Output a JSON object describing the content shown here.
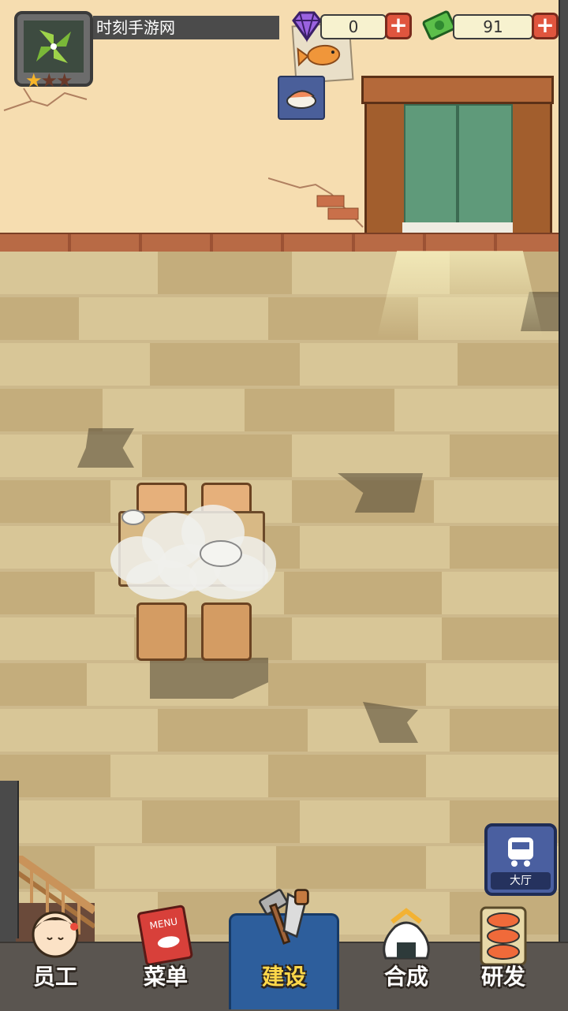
{
  "player": {
    "name": "时刻手游网",
    "stars_filled": 1,
    "stars_total": 3,
    "avatar_icon": "pinwheel-icon"
  },
  "currencies": [
    {
      "name": "gems",
      "icon": "gem-icon",
      "value": "0"
    },
    {
      "name": "cash",
      "icon": "cash-icon",
      "value": "91"
    }
  ],
  "colors": {
    "accent_red": "#e0553e",
    "active_tab": "#2d5e9c",
    "active_label": "#ffd84a",
    "lobby_button": "#4a5fa0"
  },
  "lobby": {
    "label": "大厅",
    "icon": "train-icon"
  },
  "nav": [
    {
      "label": "员工",
      "icon": "chef-girl-icon",
      "active": false
    },
    {
      "label": "菜单",
      "icon": "menu-book-icon",
      "active": false
    },
    {
      "label": "建设",
      "icon": "hammer-saw-icon",
      "active": true
    },
    {
      "label": "合成",
      "icon": "rice-ball-icon",
      "active": false
    },
    {
      "label": "研发",
      "icon": "sushi-tray-icon",
      "active": false
    }
  ],
  "scene": {
    "menu_book_text": "MENU"
  }
}
